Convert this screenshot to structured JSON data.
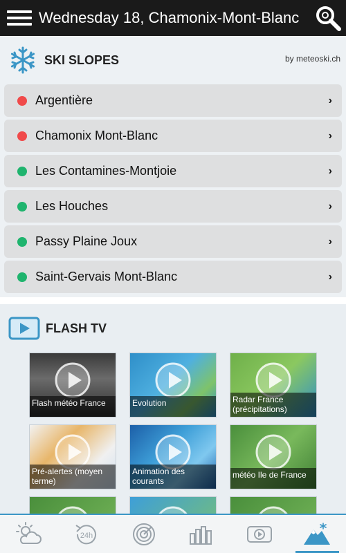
{
  "header": {
    "title": "Wednesday 18, Chamonix-Mont-Blanc",
    "menu_icon": "hamburger-menu-icon",
    "search_icon": "search-icon"
  },
  "ski_slopes": {
    "title": "SKI SLOPES",
    "byline": "by meteoski.ch",
    "icon": "snowflake-icon",
    "items": [
      {
        "name": "Argentière",
        "status": "closed",
        "status_color": "#f04a4a"
      },
      {
        "name": "Chamonix Mont-Blanc",
        "status": "closed",
        "status_color": "#f04a4a"
      },
      {
        "name": "Les Contamines-Montjoie",
        "status": "open",
        "status_color": "#1fb46e"
      },
      {
        "name": "Les Houches",
        "status": "open",
        "status_color": "#1fb46e"
      },
      {
        "name": "Passy Plaine Joux",
        "status": "open",
        "status_color": "#1fb46e"
      },
      {
        "name": "Saint-Gervais Mont-Blanc",
        "status": "open",
        "status_color": "#1fb46e"
      }
    ],
    "chevron": "›"
  },
  "flash_tv": {
    "title": "FLASH TV",
    "icon": "video-play-icon",
    "videos": [
      {
        "caption": "Flash météo France"
      },
      {
        "caption": "Evolution"
      },
      {
        "caption": "Radar France (précipitations)"
      },
      {
        "caption": "Pré-alertes (moyen terme)"
      },
      {
        "caption": "Animation des courants"
      },
      {
        "caption": "météo Ile de France"
      },
      {
        "caption": ""
      },
      {
        "caption": ""
      },
      {
        "caption": ""
      }
    ]
  },
  "bottom_nav": {
    "tabs": [
      {
        "icon": "weather-cloud-sun-icon",
        "active": false
      },
      {
        "icon": "forecast-24h-icon",
        "active": false
      },
      {
        "icon": "radar-icon",
        "active": false
      },
      {
        "icon": "bar-chart-icon",
        "active": false
      },
      {
        "icon": "video-tv-icon",
        "active": false
      },
      {
        "icon": "mountain-ski-icon",
        "active": true
      }
    ]
  },
  "colors": {
    "accent": "#3b96c6",
    "topbar": "#1a1a1a",
    "open": "#1fb46e",
    "closed": "#f04a4a"
  }
}
